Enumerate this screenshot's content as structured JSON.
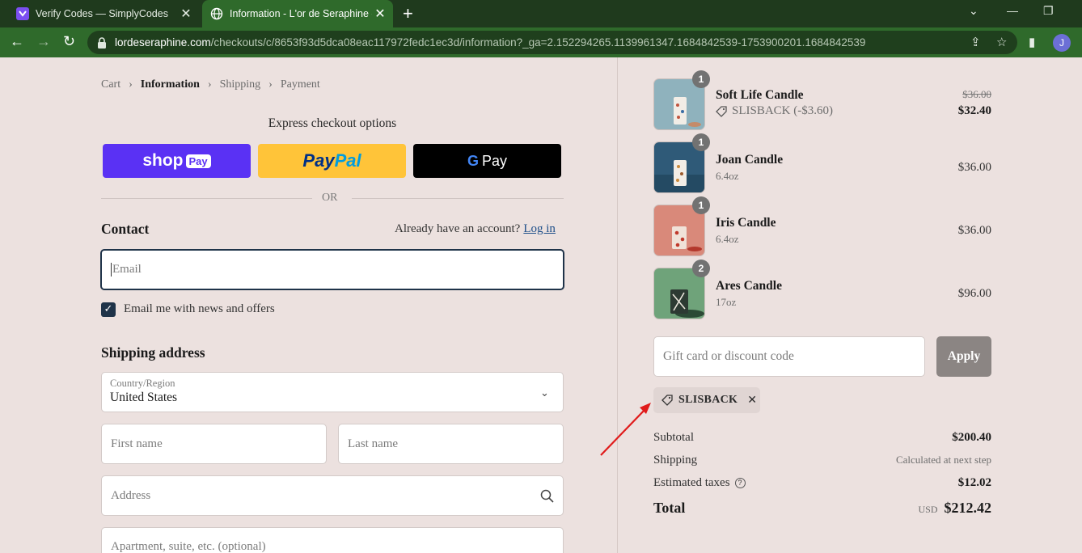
{
  "browser": {
    "tabs": [
      {
        "title": "Verify Codes — SimplyCodes"
      },
      {
        "title": "Information - L'or de Seraphine -"
      }
    ],
    "url_host": "lordeseraphine.com",
    "url_path": "/checkouts/c/8653f93d5dca08eac117972fedc1ec3d/information?_ga=2.152294265.1139961347.1684842539-1753900201.1684842539",
    "avatar_letter": "J"
  },
  "breadcrumb": [
    "Cart",
    "Information",
    "Shipping",
    "Payment"
  ],
  "express": {
    "title": "Express checkout options",
    "shoppay_brand": "shop",
    "shoppay_badge": "Pay",
    "paypal_1": "Pay",
    "paypal_2": "Pal",
    "gpay_g": "G",
    "gpay_label": "Pay",
    "or": "OR"
  },
  "contact": {
    "heading": "Contact",
    "account_prompt": "Already have an account?",
    "login": "Log in",
    "email_placeholder": "Email",
    "newsletter_label": "Email me with news and offers"
  },
  "shipping": {
    "heading": "Shipping address",
    "country_label": "Country/Region",
    "country_value": "United States",
    "first_name": "First name",
    "last_name": "Last name",
    "address": "Address",
    "apartment": "Apartment, suite, etc. (optional)"
  },
  "cart": {
    "items": [
      {
        "qty": "1",
        "name": "Soft Life Candle",
        "variant": "",
        "discount": "SLISBACK (-$3.60)",
        "original_price": "$36.00",
        "price": "$32.40",
        "thumb_bg": "#8fb2bd"
      },
      {
        "qty": "1",
        "name": "Joan Candle",
        "variant": "6.4oz",
        "price": "$36.00",
        "thumb_bg": "#2f5a78"
      },
      {
        "qty": "1",
        "name": "Iris Candle",
        "variant": "6.4oz",
        "price": "$36.00",
        "thumb_bg": "#d9897a"
      },
      {
        "qty": "2",
        "name": "Ares Candle",
        "variant": "17oz",
        "price": "$96.00",
        "thumb_bg": "#6fa37a"
      }
    ],
    "gift_placeholder": "Gift card or discount code",
    "apply": "Apply",
    "applied_code": "SLISBACK"
  },
  "summary": {
    "subtotal_label": "Subtotal",
    "subtotal": "$200.40",
    "shipping_label": "Shipping",
    "shipping": "Calculated at next step",
    "taxes_label": "Estimated taxes",
    "taxes": "$12.02",
    "total_label": "Total",
    "currency": "USD",
    "total": "$212.42"
  },
  "colors": {
    "page_bg": "#ece1df",
    "chrome_tabbar": "#1f3a1d",
    "chrome_active": "#2f6a2b",
    "shoppay": "#5a31f4",
    "paypal": "#ffc439",
    "annotation_arrow": "#e01b1b"
  }
}
